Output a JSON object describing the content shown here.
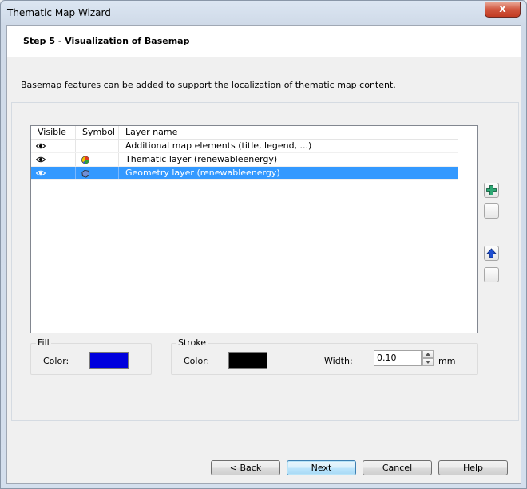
{
  "window": {
    "title": "Thematic Map Wizard",
    "close_glyph": "x"
  },
  "header": {
    "step_title": "Step 5 - Visualization of Basemap"
  },
  "description": "Basemap features can be added to support the localization of thematic map content.",
  "layer_list": {
    "columns": [
      "Visible",
      "Symbol",
      "Layer name"
    ],
    "rows": [
      {
        "name": "Additional map elements (title, legend, ...)",
        "visible_icon": "eye-icon",
        "symbol_icon": "",
        "selected": false
      },
      {
        "name": "Thematic layer (renewableenergy)",
        "visible_icon": "eye-icon",
        "symbol_icon": "pie-chart-symbol-icon",
        "selected": false
      },
      {
        "name": "Geometry layer (renewableenergy)",
        "visible_icon": "eye-icon",
        "symbol_icon": "polygon-symbol-icon",
        "selected": true
      }
    ]
  },
  "side_buttons": [
    "add-layer-icon",
    "blank",
    "move-up-icon",
    "blank"
  ],
  "fill": {
    "group_label": "Fill",
    "color_label": "Color:",
    "color": "#0000dd"
  },
  "stroke": {
    "group_label": "Stroke",
    "color_label": "Color:",
    "color": "#000000",
    "width_label": "Width:",
    "width_value": "0.10",
    "unit": "mm"
  },
  "buttons": {
    "back": "< Back",
    "next": "Next",
    "cancel": "Cancel",
    "help": "Help"
  },
  "colors": {
    "selection": "#3399ff",
    "add_icon": "#1c8a5e",
    "up_icon": "#1f4fd1"
  }
}
